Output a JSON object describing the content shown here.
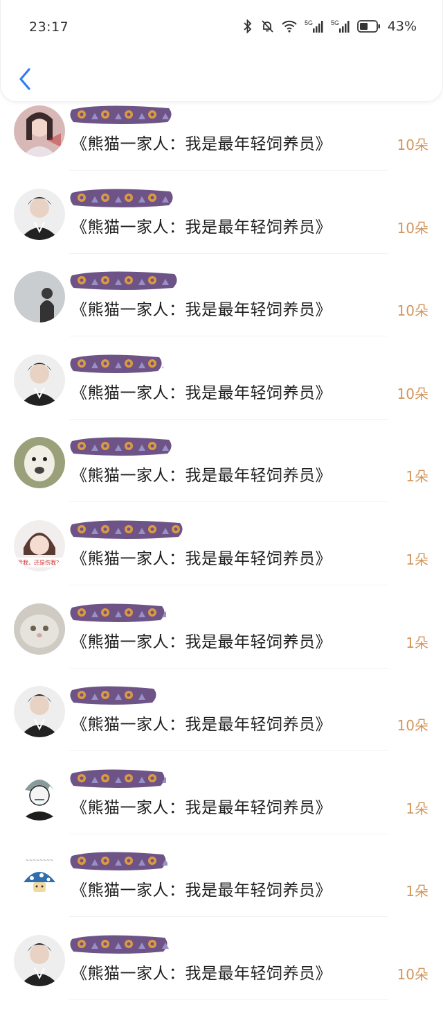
{
  "status_bar": {
    "time": "23:17",
    "battery_percent": "43%",
    "icons": [
      "bluetooth-icon",
      "mute-icon",
      "wifi-icon",
      "5g-signal-icon",
      "5g-signal-icon",
      "battery-icon"
    ]
  },
  "nav": {
    "back_icon": "chevron-left-icon"
  },
  "colors": {
    "accent": "#2e7ef0",
    "count": "#d2955a",
    "redaction": "#6e5486"
  },
  "records": [
    {
      "gift": "《熊猫一家人：我是最年轻饲养员》",
      "count": "10朵",
      "avatar": "photo"
    },
    {
      "gift": "《熊猫一家人：我是最年轻饲养员》",
      "count": "10朵",
      "avatar": "photo"
    },
    {
      "gift": "《熊猫一家人：我是最年轻饲养员》",
      "count": "10朵",
      "avatar": "photo"
    },
    {
      "gift": "《熊猫一家人：我是最年轻饲养员》",
      "count": "10朵",
      "avatar": "photo"
    },
    {
      "gift": "《熊猫一家人：我是最年轻饲养员》",
      "count": "1朵",
      "avatar": "photo"
    },
    {
      "gift": "《熊猫一家人：我是最年轻饲养员》",
      "count": "1朵",
      "avatar": "photo",
      "avatar_caption": "爱我，还是伤我？"
    },
    {
      "gift": "《熊猫一家人：我是最年轻饲养员》",
      "count": "1朵",
      "avatar": "photo"
    },
    {
      "gift": "《熊猫一家人：我是最年轻饲养员》",
      "count": "10朵",
      "avatar": "photo"
    },
    {
      "gift": "《熊猫一家人：我是最年轻饲养员》",
      "count": "1朵",
      "avatar": "photo"
    },
    {
      "gift": "《熊猫一家人：我是最年轻饲养员》",
      "count": "1朵",
      "avatar": "photo"
    },
    {
      "gift": "《熊猫一家人：我是最年轻饲养员》",
      "count": "10朵",
      "avatar": "photo"
    }
  ]
}
